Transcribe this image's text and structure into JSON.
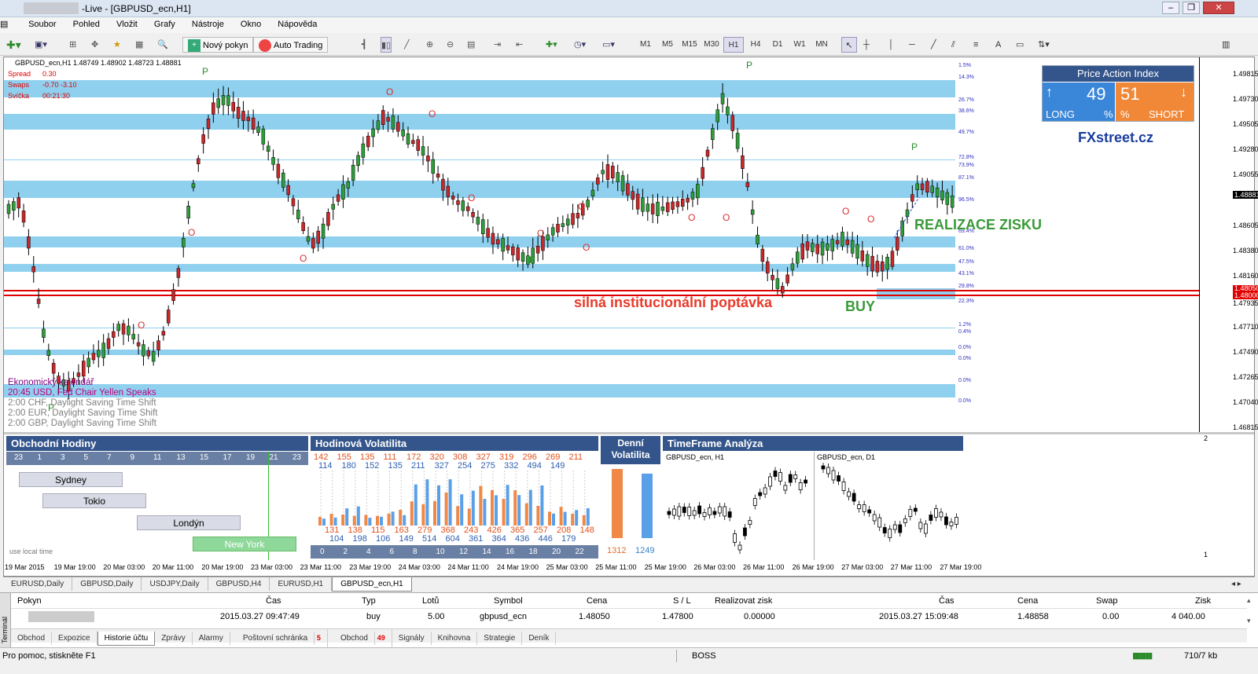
{
  "window": {
    "title": "-Live - [GBPUSD_ecn,H1]"
  },
  "menu": [
    "Soubor",
    "Pohled",
    "Vložit",
    "Grafy",
    "Nástroje",
    "Okno",
    "Nápověda"
  ],
  "toolbar": {
    "new_order": "Nový pokyn",
    "auto_trading": "Auto Trading",
    "timeframes": [
      "M1",
      "M5",
      "M15",
      "M30",
      "H1",
      "H4",
      "D1",
      "W1",
      "MN"
    ]
  },
  "chart": {
    "header": "GBPUSD_ecn,H1  1.48749 1.48902 1.48723 1.48881",
    "info": [
      {
        "label": "Spread",
        "value": "0.30"
      },
      {
        "label": "Swaps",
        "value": "-0.70 -3.10"
      },
      {
        "label": "Svíčka",
        "value": "00:21:30"
      }
    ],
    "price_axis": [
      "1.49815",
      "1.49730",
      "1.49505",
      "1.49280",
      "1.49055",
      "1.48881",
      "1.48605",
      "1.48380",
      "1.48160",
      "1.48050",
      "1.48000",
      "1.47935",
      "1.47710",
      "1.47490",
      "1.47265",
      "1.47040",
      "1.46815"
    ],
    "time_axis": [
      "19 Mar 2015",
      "19 Mar 19:00",
      "20 Mar 03:00",
      "20 Mar 11:00",
      "20 Mar 19:00",
      "23 Mar 03:00",
      "23 Mar 11:00",
      "23 Mar 19:00",
      "24 Mar 03:00",
      "24 Mar 11:00",
      "24 Mar 19:00",
      "25 Mar 03:00",
      "25 Mar 11:00",
      "25 Mar 19:00",
      "26 Mar 03:00",
      "26 Mar 11:00",
      "26 Mar 19:00",
      "27 Mar 03:00",
      "27 Mar 11:00",
      "27 Mar 19:00"
    ],
    "pct_labels": [
      "1.5%",
      "14.3%",
      "26.7%",
      "38.6%",
      "49.7%",
      "72.8%",
      "73.9%",
      "87.1%",
      "96.5%",
      "69.4%",
      "61.0%",
      "47.5%",
      "43.1%",
      "29.8%",
      "22.3%",
      "1.2%",
      "0.4%",
      "0.0%",
      "0.0%",
      "0.0%",
      "0.0%"
    ],
    "annotations": {
      "realizace": "REALIZACE ZISKU",
      "poptavka": "silná institucionální poptávka",
      "buy": "BUY"
    },
    "news": [
      {
        "text": "Ekonomický kalendář",
        "color": "#800080"
      },
      {
        "text": "20:45 USD, Fed Chair Yellen Speaks",
        "color": "#c00080"
      },
      {
        "text": "2:00 CHF, Daylight Saving Time Shift",
        "color": "#808080"
      },
      {
        "text": "2:00 EUR, Daylight Saving Time Shift",
        "color": "#808080"
      },
      {
        "text": "2:00 GBP, Daylight Saving Time Shift",
        "color": "#808080"
      }
    ],
    "pai": {
      "title": "Price Action Index",
      "long_value": "49",
      "long_label": "LONG",
      "short_value": "51",
      "short_label": "SHORT",
      "pct": "%",
      "brand": "FXstreet.cz"
    },
    "subwindow_labels": [
      "2",
      "1"
    ]
  },
  "panels": {
    "hodiny": {
      "title": "Obchodní Hodiny",
      "hours": [
        "23",
        "1",
        "3",
        "5",
        "7",
        "9",
        "11",
        "13",
        "15",
        "17",
        "19",
        "21",
        "23"
      ],
      "sessions": [
        "Sydney",
        "Tokio",
        "Londýn",
        "New York"
      ],
      "footer": "use local time"
    },
    "volatilita": {
      "title": "Hodinová Volatilita",
      "top1": [
        "142",
        "155",
        "135",
        "111",
        "172",
        "320",
        "308",
        "327",
        "319",
        "296",
        "269",
        "211"
      ],
      "top2": [
        "114",
        "180",
        "152",
        "135",
        "211",
        "327",
        "254",
        "275",
        "332",
        "494",
        "149"
      ],
      "bot1": [
        "131",
        "138",
        "115",
        "163",
        "279",
        "368",
        "243",
        "426",
        "365",
        "257",
        "208",
        "148"
      ],
      "bot2": [
        "104",
        "198",
        "106",
        "149",
        "514",
        "604",
        "361",
        "364",
        "436",
        "446",
        "179"
      ],
      "hours": [
        "0",
        "2",
        "4",
        "6",
        "8",
        "10",
        "12",
        "14",
        "16",
        "18",
        "20",
        "22"
      ]
    },
    "denni": {
      "title": "Denní Volatilita",
      "v1": "1312",
      "v2": "1249"
    },
    "timeframe": {
      "title": "TimeFrame Analýza",
      "h1": "GBPUSD_ecn, H1",
      "d1": "GBPUSD_ecn, D1"
    }
  },
  "chart_tabs": [
    "EURUSD,Daily",
    "GBPUSD,Daily",
    "USDJPY,Daily",
    "GBPUSD,H4",
    "EURUSD,H1",
    "GBPUSD_ecn,H1"
  ],
  "terminal": {
    "columns": [
      "Pokyn",
      "Čas",
      "Typ",
      "Lotů",
      "Symbol",
      "Cena",
      "S / L",
      "Realizovat zisk",
      "Čas",
      "Cena",
      "Swap",
      "Zisk"
    ],
    "row": [
      "",
      "2015.03.27 09:47:49",
      "buy",
      "5.00",
      "gbpusd_ecn",
      "1.48050",
      "1.47800",
      "0.00000",
      "2015.03.27 15:09:48",
      "1.48858",
      "0.00",
      "4 040.00"
    ],
    "tabs": [
      "Obchod",
      "Expozice",
      "Historie účtu",
      "Zprávy",
      "Alarmy",
      "Poštovní schránka",
      "Obchod",
      "Signály",
      "Knihovna",
      "Strategie",
      "Deník"
    ],
    "tab_badges": {
      "mail": "5",
      "obchod": "49"
    },
    "side_label": "Terminál"
  },
  "status": {
    "help": "Pro pomoc, stiskněte F1",
    "profile": "BOSS",
    "traffic": "710/7 kb"
  }
}
